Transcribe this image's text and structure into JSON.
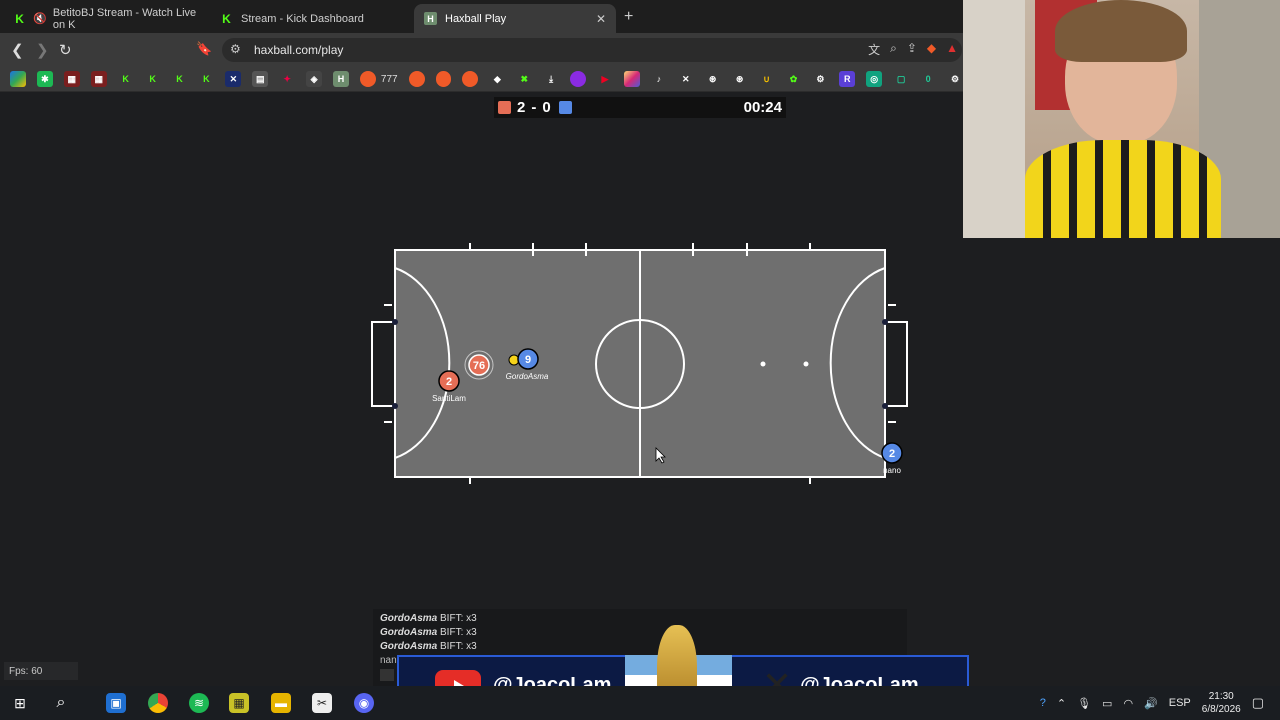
{
  "tabs": [
    {
      "title": "BetitoBJ Stream - Watch Live on K"
    },
    {
      "title": "Stream - Kick Dashboard"
    },
    {
      "title": "Haxball Play"
    }
  ],
  "address_bar": {
    "url": "haxball.com/play"
  },
  "bookmarks_text": "777",
  "score": {
    "red": "2",
    "separator": "-",
    "blue": "0",
    "time": "00:24"
  },
  "colors": {
    "red_team": "#e56e56",
    "blue_team": "#5689e5",
    "pitch": "#6f6f6f",
    "kick_green": "#53fc18",
    "banner_blue": "#0c1a44"
  },
  "players": [
    {
      "number": "2",
      "name": "SantiLam",
      "team": "red"
    },
    {
      "number": "76",
      "name": "",
      "team": "red"
    },
    {
      "number": "9",
      "name": "GordoAsma",
      "team": "blue"
    },
    {
      "number": "2",
      "name": "nano",
      "team": "blue"
    }
  ],
  "fps": "Fps: 60",
  "chat": [
    {
      "nick": "GordoAsma",
      "text": "BIFT: x3"
    },
    {
      "nick": "GordoAsma",
      "text": "BIFT: x3"
    },
    {
      "nick": "GordoAsma",
      "text": "BIFT: x3"
    },
    {
      "nick": "nan",
      "text": ""
    }
  ],
  "banner": {
    "youtube_handle": "@JoacoLam_",
    "x_handle": "@JoacoLam"
  },
  "tray": {
    "language": "ESP",
    "time": "21:30",
    "date": "6/8/2026"
  }
}
